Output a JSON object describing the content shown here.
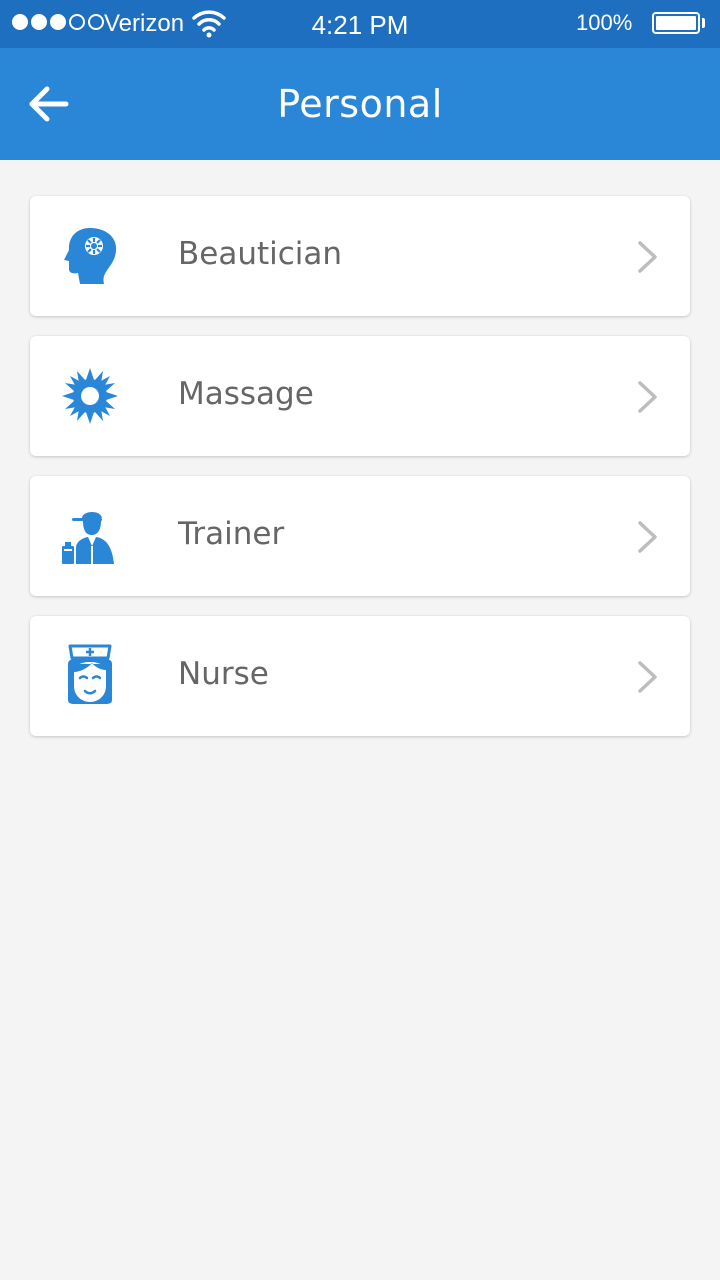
{
  "status_bar": {
    "carrier": "Verizon",
    "time": "4:21 PM",
    "battery": "100%",
    "signal_bars_filled": 3,
    "signal_bars_total": 5
  },
  "header": {
    "title": "Personal",
    "back_icon": "arrow-left-icon",
    "background": "#2a86d6"
  },
  "items": [
    {
      "label": "Beautician",
      "icon": "beautician-icon"
    },
    {
      "label": "Massage",
      "icon": "massage-icon"
    },
    {
      "label": "Trainer",
      "icon": "trainer-icon"
    },
    {
      "label": "Nurse",
      "icon": "nurse-icon"
    }
  ],
  "colors": {
    "accent": "#2a86d6",
    "status_bar": "#1e6fbf",
    "icon": "#2a86d6",
    "label": "#666666",
    "chevron": "#bdbdbd"
  }
}
